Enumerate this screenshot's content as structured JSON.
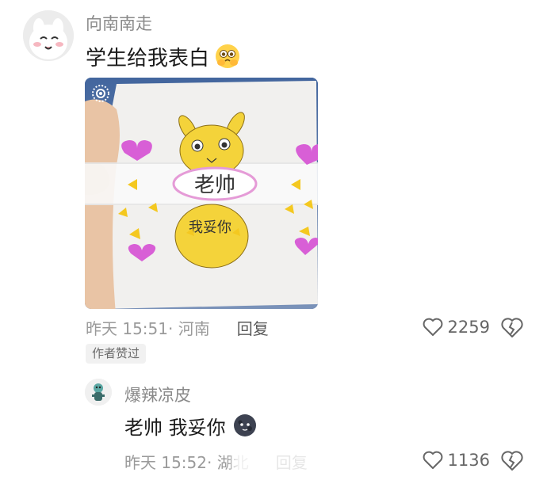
{
  "comment": {
    "username": "向南南走",
    "text": "学生给我表白",
    "emoji_icon": "shy-face-emoji-icon",
    "time": "昨天 15:51",
    "separator": "·",
    "location": "河南",
    "reply_label": "回复",
    "like_count": "2259",
    "badge": "作者赞过",
    "photo_note_text": "老帅",
    "photo_note_text2": "我妥你"
  },
  "sub_comment": {
    "username": "爆辣凉皮",
    "text": "老帅 我妥你",
    "emoji_icon": "dark-moon-face-emoji-icon",
    "time": "昨天 15:52",
    "separator": "·",
    "location": "湖北",
    "reply_label": "回复",
    "like_count": "1136"
  },
  "colors": {
    "meta_gray": "#9a9a9a",
    "text_dark": "#1b1b1b",
    "badge_bg": "#f1f1f1",
    "drawing_yellow": "#f4d33a",
    "drawing_pink": "#d85fd6"
  }
}
